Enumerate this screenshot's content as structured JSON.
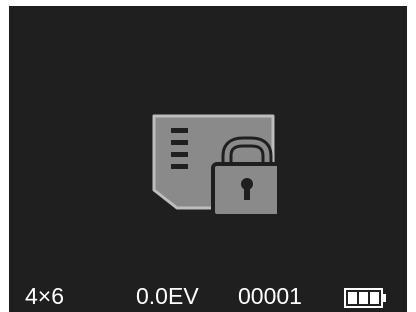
{
  "status_bar": {
    "print_size": "4×6",
    "exposure_compensation": "0.0EV",
    "frame_counter": "00001",
    "battery_icon": "battery-full-icon"
  },
  "center_graphic": {
    "icon": "memory-card-locked-icon"
  },
  "colors": {
    "screen_background": "#1f1f1f",
    "icon_fill": "#8a8a8a",
    "icon_outline": "#555555",
    "text": "#ffffff"
  }
}
